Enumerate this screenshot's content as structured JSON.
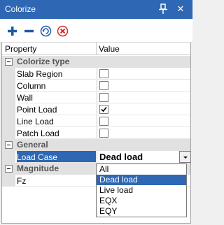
{
  "window": {
    "title": "Colorize"
  },
  "grid": {
    "headers": {
      "property": "Property",
      "value": "Value"
    },
    "categories": {
      "colorize_type": "Colorize type",
      "general": "General",
      "magnitude": "Magnitude"
    },
    "rows": [
      {
        "label": "Slab Region",
        "checked": false
      },
      {
        "label": "Column",
        "checked": false
      },
      {
        "label": "Wall",
        "checked": false
      },
      {
        "label": "Point Load",
        "checked": true
      },
      {
        "label": "Line Load",
        "checked": false
      },
      {
        "label": "Patch Load",
        "checked": false
      }
    ],
    "load_case": {
      "label": "Load Case",
      "value": "Dead load"
    },
    "fz": {
      "label": "Fz"
    }
  },
  "dropdown": {
    "options": [
      "All",
      "Dead load",
      "Live load",
      "EQX",
      "EQY"
    ],
    "selected_index": 1
  },
  "colors": {
    "titlebar": "#2e67b3",
    "selection": "#2e67b3",
    "category_bg": "#e1e1e1",
    "add": "#1f5aa6",
    "remove": "#1f5aa6",
    "clear": "#d42b2b"
  },
  "icons": [
    "pin-icon",
    "close-icon",
    "add-icon",
    "remove-icon",
    "refresh-icon",
    "clear-icon",
    "chevron-down-icon",
    "checkmark-icon"
  ]
}
